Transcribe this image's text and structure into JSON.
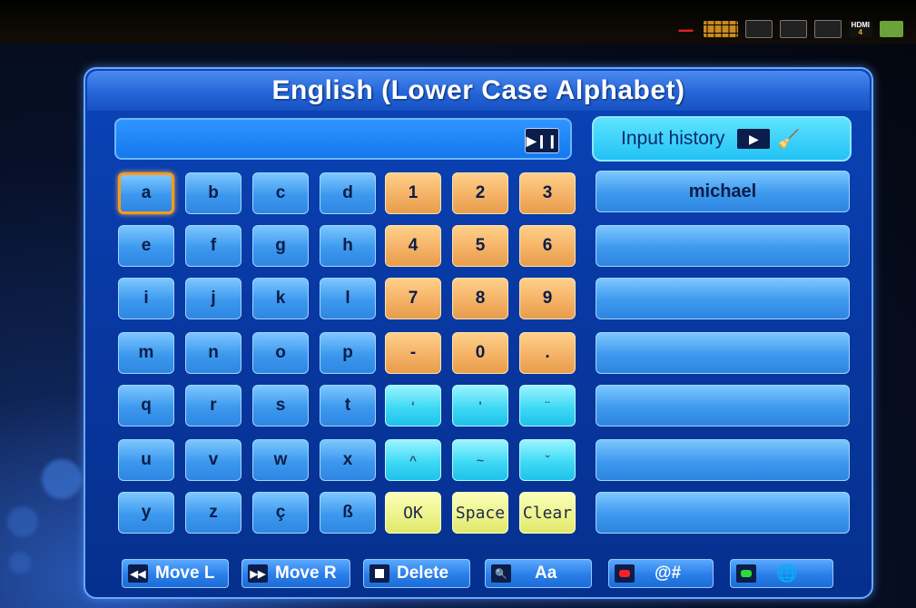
{
  "title": "English (Lower Case Alphabet)",
  "input": {
    "value": "",
    "playpause_icon": "▶❙❙"
  },
  "history": {
    "header_label": "Input history",
    "arrow_icon": "▶",
    "broom_icon": "🧹",
    "items": [
      "michael",
      "",
      "",
      "",
      "",
      "",
      ""
    ]
  },
  "keyboard": {
    "letters": [
      [
        "a",
        "b",
        "c",
        "d"
      ],
      [
        "e",
        "f",
        "g",
        "h"
      ],
      [
        "i",
        "j",
        "k",
        "l"
      ],
      [
        "m",
        "n",
        "o",
        "p"
      ],
      [
        "q",
        "r",
        "s",
        "t"
      ],
      [
        "u",
        "v",
        "w",
        "x"
      ],
      [
        "y",
        "z",
        "ç",
        "ß"
      ]
    ],
    "digits": [
      [
        "1",
        "2",
        "3"
      ],
      [
        "4",
        "5",
        "6"
      ],
      [
        "7",
        "8",
        "9"
      ],
      [
        "-",
        "0",
        "."
      ]
    ],
    "symbols": [
      [
        "‘",
        "'",
        "¨"
      ],
      [
        "^",
        "~",
        "ˇ"
      ]
    ],
    "actions": [
      "OK",
      "Space",
      "Clear"
    ],
    "focused_key": "a"
  },
  "footer": {
    "move_left": {
      "icon": "◀◀",
      "label": "Move L"
    },
    "move_right": {
      "icon": "▶▶",
      "label": "Move R"
    },
    "delete": {
      "icon": "■",
      "label": "Delete"
    },
    "case": {
      "icon": "🔍",
      "label": "Aa"
    },
    "symbols": {
      "icon": "red-button",
      "label": "@#"
    },
    "language": {
      "icon": "green-button",
      "label": "🌐"
    }
  },
  "colors": {
    "panel": "#0838a2",
    "letter_key": "#3c98ee",
    "digit_key": "#f5b266",
    "symbol_key": "#3fd9f5",
    "action_key": "#eef38d",
    "focus": "#ff9a1a"
  }
}
